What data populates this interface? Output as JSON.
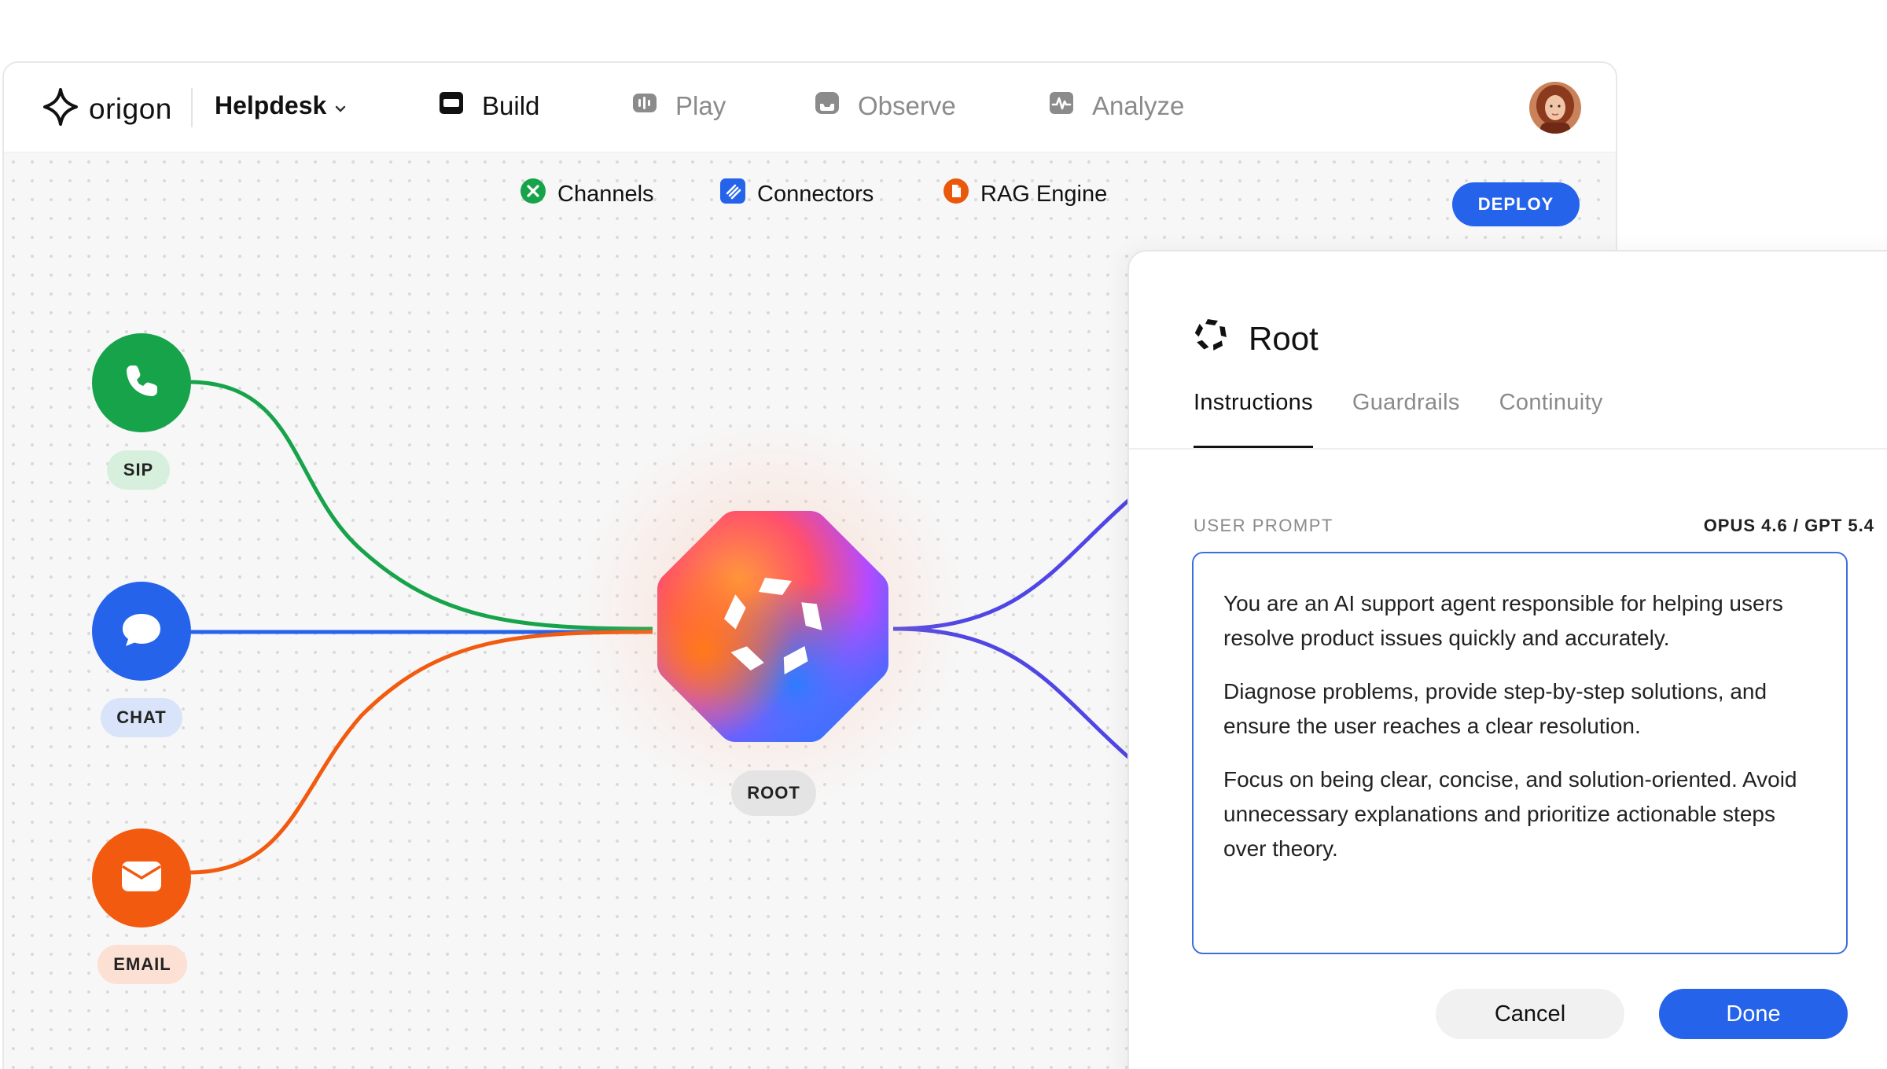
{
  "brand": {
    "name": "origon",
    "logo_icon": "diamond-star-icon"
  },
  "project": {
    "name": "Helpdesk",
    "icon": "chevron-down-icon"
  },
  "nav": {
    "items": [
      {
        "label": "Build",
        "icon": "build-icon",
        "active": true
      },
      {
        "label": "Play",
        "icon": "play-waveform-icon",
        "active": false
      },
      {
        "label": "Observe",
        "icon": "observe-tray-icon",
        "active": false
      },
      {
        "label": "Analyze",
        "icon": "analyze-pulse-icon",
        "active": false
      }
    ]
  },
  "subnav": {
    "items": [
      {
        "label": "Channels",
        "icon": "channels-icon",
        "color": "#16a34a"
      },
      {
        "label": "Connectors",
        "icon": "connectors-icon",
        "color": "#2563eb"
      },
      {
        "label": "RAG Engine",
        "icon": "rag-document-icon",
        "color": "#ea580c"
      }
    ],
    "deploy_label": "DEPLOY"
  },
  "flow": {
    "channels": [
      {
        "label": "SIP",
        "icon": "phone-icon",
        "color": "#16a34a",
        "pill_color": "#d6f0dd"
      },
      {
        "label": "CHAT",
        "icon": "chat-bubble-icon",
        "color": "#2563eb",
        "pill_color": "#d9e4fb"
      },
      {
        "label": "EMAIL",
        "icon": "mail-icon",
        "color": "#f25a0f",
        "pill_color": "#fbe0d3"
      }
    ],
    "root_label": "ROOT",
    "output_line_color": "#4f46e5"
  },
  "panel": {
    "title": "Root",
    "title_icon": "root-ring-icon",
    "tabs": [
      {
        "label": "Instructions",
        "active": true
      },
      {
        "label": "Guardrails",
        "active": false
      },
      {
        "label": "Continuity",
        "active": false
      }
    ],
    "section_label": "USER PROMPT",
    "model_label": "OPUS 4.6 / GPT 5.4",
    "prompt": [
      "You are an AI support agent responsible for helping users resolve product issues quickly and accurately.",
      "Diagnose problems, provide step-by-step solutions, and ensure the user reaches a clear resolution.",
      "Focus on being clear, concise, and solution-oriented. Avoid unnecessary explanations and prioritize actionable steps over theory."
    ],
    "cancel_label": "Cancel",
    "done_label": "Done"
  },
  "colors": {
    "accent": "#2563eb",
    "sip": "#16a34a",
    "chat": "#2563eb",
    "email": "#f25a0f",
    "output": "#4f46e5"
  }
}
